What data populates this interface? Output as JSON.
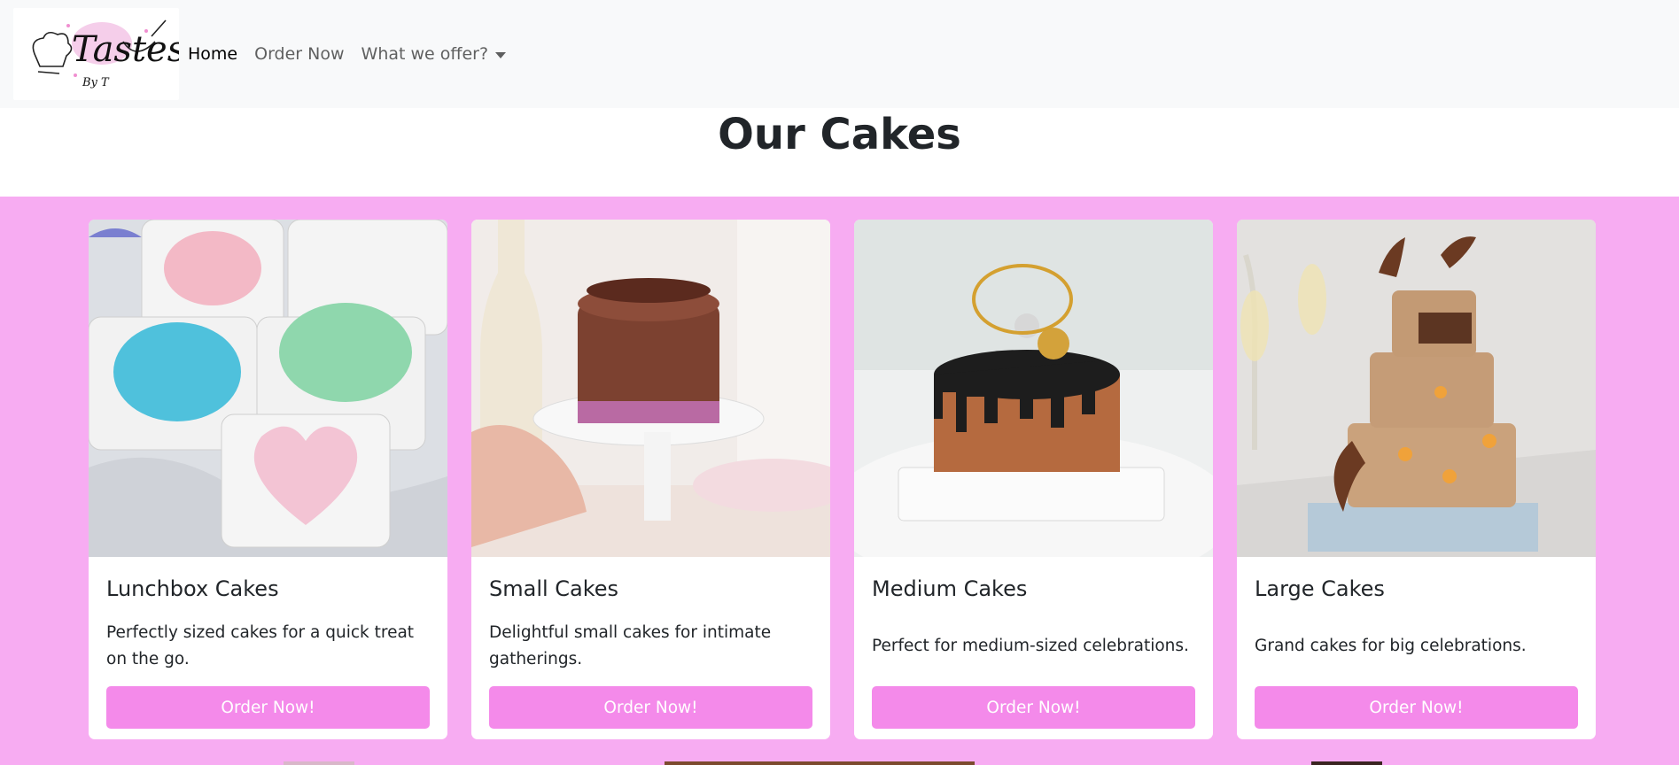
{
  "brand": {
    "logo_text": "Tastes",
    "logo_subtext": "By T"
  },
  "nav": {
    "items": [
      {
        "label": "Home",
        "active": true
      },
      {
        "label": "Order Now",
        "active": false
      },
      {
        "label": "What we offer?",
        "active": false,
        "dropdown": true
      }
    ]
  },
  "page": {
    "title": "Our Cakes"
  },
  "colors": {
    "section_bg": "#f7acf2",
    "button_bg": "#f48aea",
    "navbar_bg": "#f8f9fa"
  },
  "cards": [
    {
      "title": "Lunchbox Cakes",
      "description": "Perfectly sized cakes for a quick treat on the go.",
      "button": "Order Now!",
      "image": "lunchbox-cakes-photo"
    },
    {
      "title": "Small Cakes",
      "description": "Delightful small cakes for intimate gatherings.",
      "button": "Order Now!",
      "image": "small-chocolate-cake-photo"
    },
    {
      "title": "Medium Cakes",
      "description": "Perfect for medium-sized celebrations.",
      "button": "Order Now!",
      "image": "medium-birthday-cake-photo"
    },
    {
      "title": "Large Cakes",
      "description": "Grand cakes for big celebrations.",
      "button": "Order Now!",
      "image": "large-tiered-cake-photo"
    }
  ]
}
